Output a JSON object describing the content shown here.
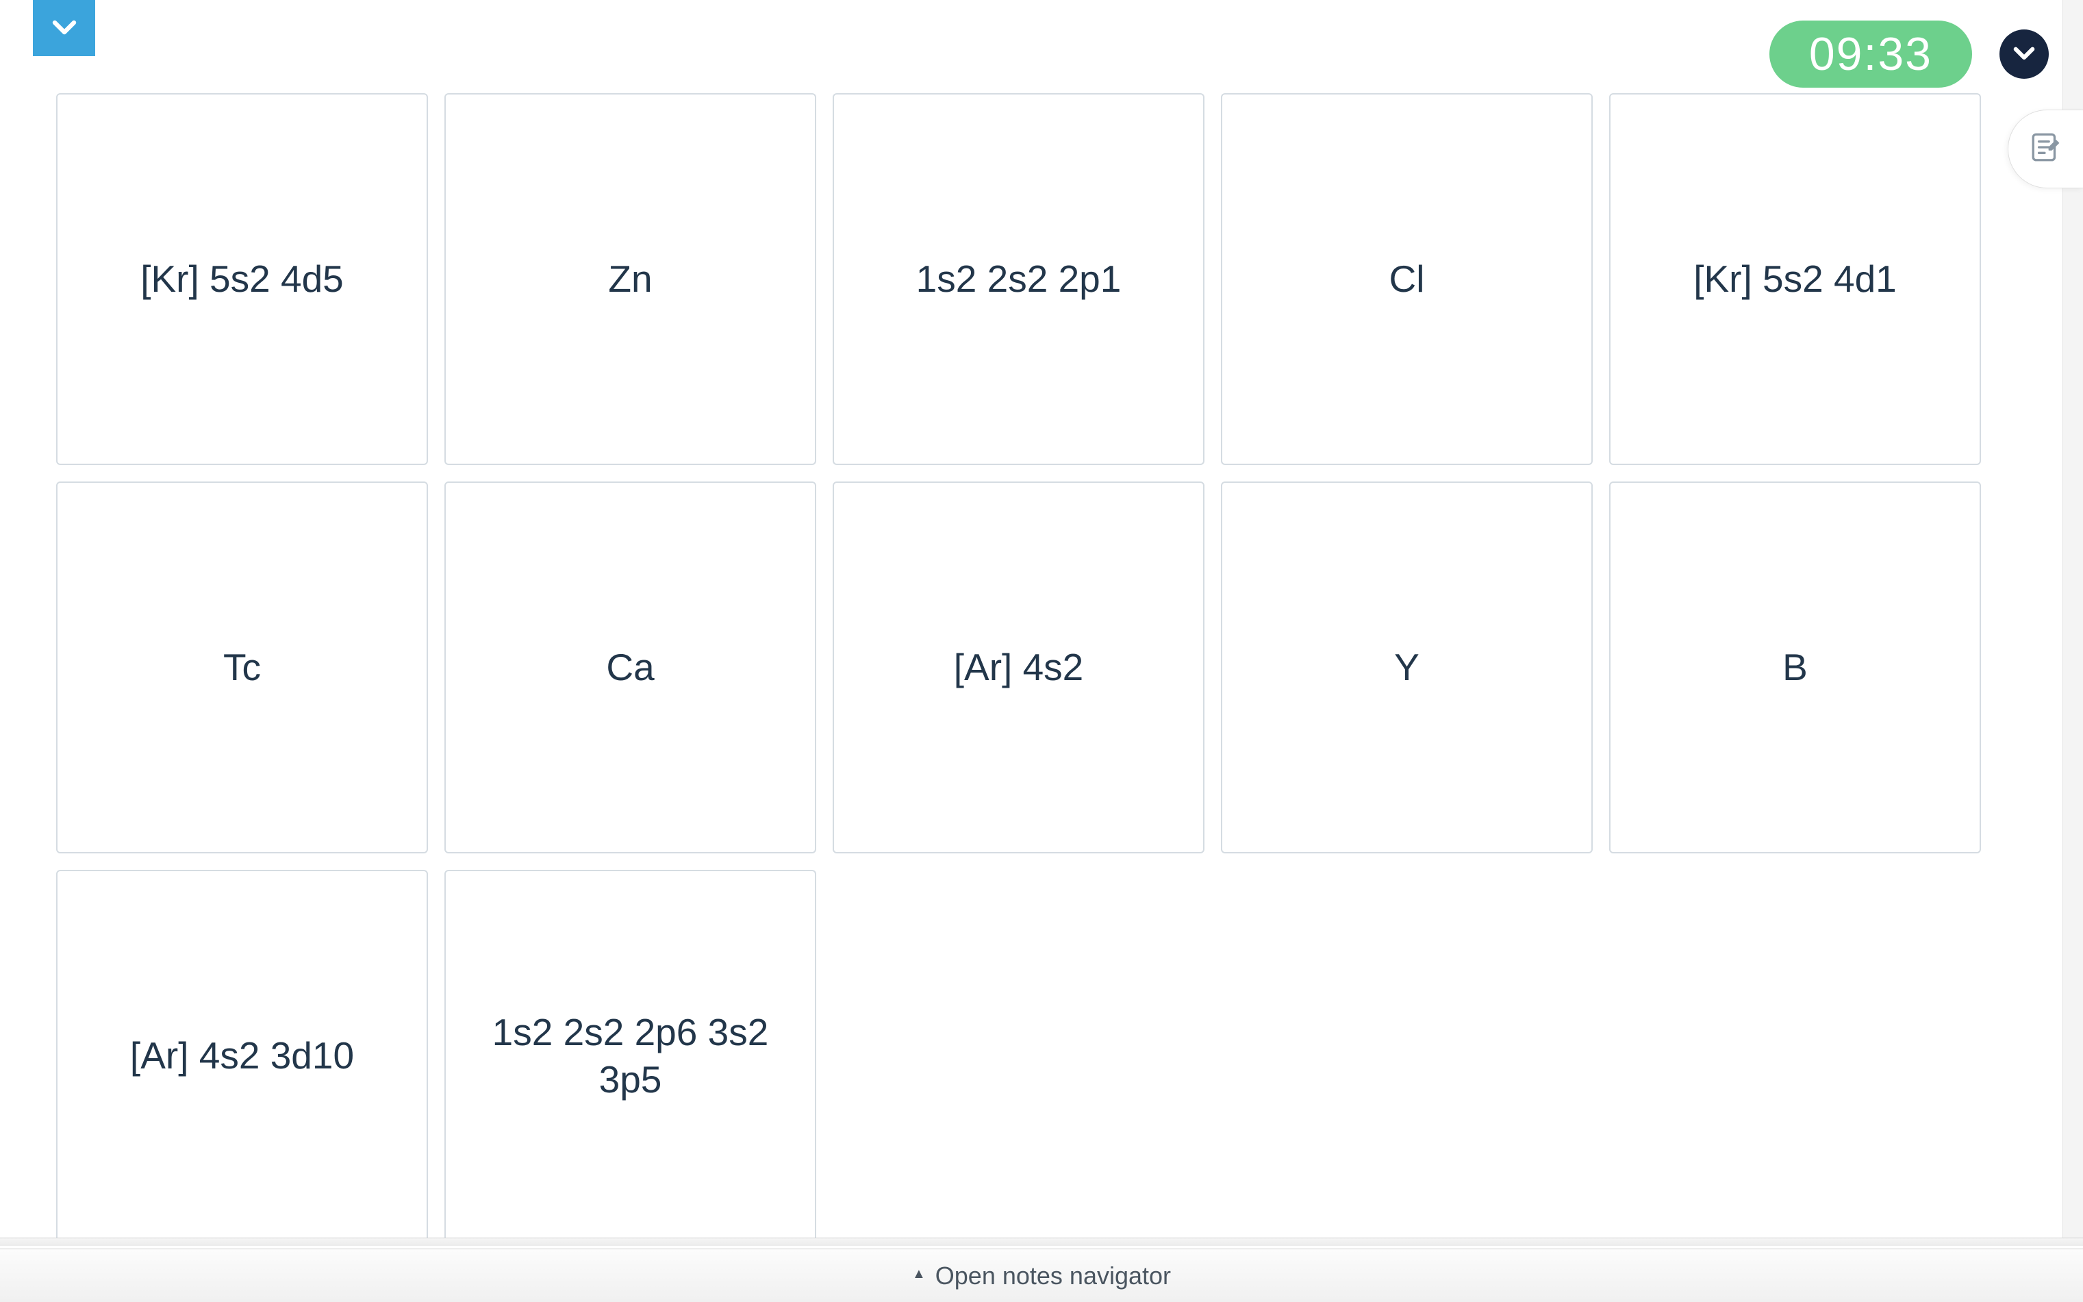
{
  "header": {
    "timer": "09:33"
  },
  "cards": [
    "[Kr] 5s2 4d5",
    "Zn",
    "1s2 2s2 2p1",
    "Cl",
    "[Kr] 5s2 4d1",
    "Tc",
    "Ca",
    "[Ar] 4s2",
    "Y",
    "B",
    "[Ar] 4s2 3d10",
    "1s2 2s2 2p6 3s2 3p5"
  ],
  "footer": {
    "notes_navigator_label": "Open notes navigator"
  }
}
